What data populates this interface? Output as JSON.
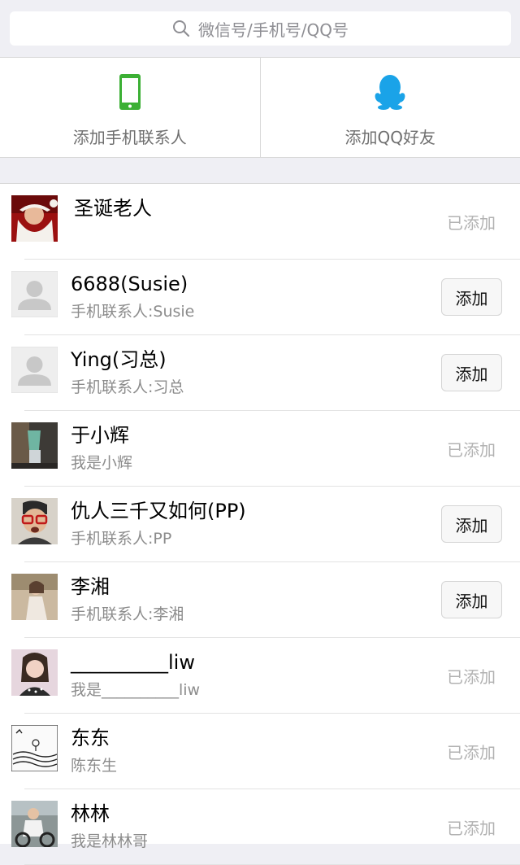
{
  "search": {
    "placeholder": "微信号/手机号/QQ号",
    "icon": "search-icon"
  },
  "shortcuts": [
    {
      "label": "添加手机联系人",
      "icon": "phone-icon",
      "color": "#3cb035"
    },
    {
      "label": "添加QQ好友",
      "icon": "qq-penguin-icon",
      "color": "#1aa3e8"
    }
  ],
  "contacts": [
    {
      "name": "圣诞老人",
      "sub": "",
      "status": "已添加",
      "action": ""
    },
    {
      "name": "6688(Susie)",
      "sub": "手机联系人:Susie",
      "status": "",
      "action": "添加"
    },
    {
      "name": "Ying(习总)",
      "sub": "手机联系人:习总",
      "status": "",
      "action": "添加"
    },
    {
      "name": "于小辉",
      "sub": "我是小辉",
      "status": "已添加",
      "action": ""
    },
    {
      "name": "仇人三千又如何(PP)",
      "sub": "手机联系人:PP",
      "status": "",
      "action": "添加"
    },
    {
      "name": "李湘",
      "sub": "手机联系人:李湘",
      "status": "",
      "action": "添加"
    },
    {
      "name": "__________liw",
      "sub": "我是__________liw",
      "status": "已添加",
      "action": ""
    },
    {
      "name": "东东",
      "sub": "陈东生",
      "status": "已添加",
      "action": ""
    },
    {
      "name": "林林",
      "sub": "我是林林哥",
      "status": "已添加",
      "action": ""
    }
  ]
}
